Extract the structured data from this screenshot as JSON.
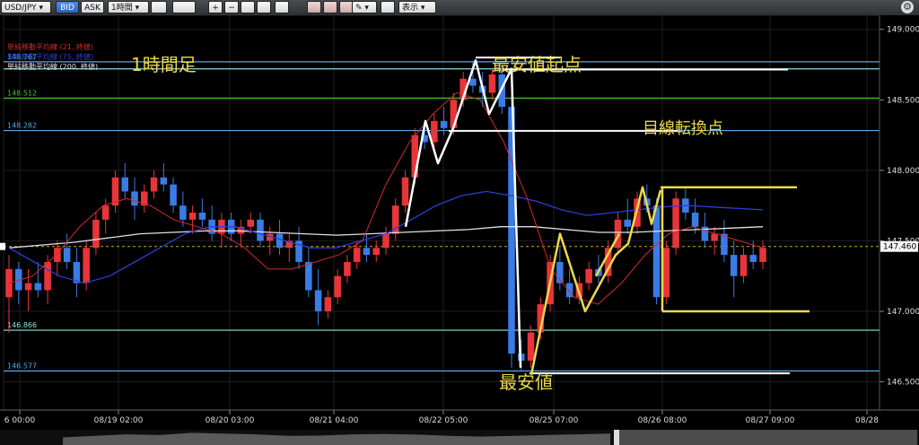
{
  "toolbar": {
    "symbol": "USD/JPY",
    "bid": "BID",
    "ask": "ASK",
    "timeframe": "1時間",
    "display": "表示"
  },
  "indicator_legend": [
    {
      "label": "単純移動平均線 (21, 終値)",
      "color": "#d42a2a"
    },
    {
      "label": "単純移動平均線 (75, 終値)",
      "color": "#2a3ed4"
    },
    {
      "label": "単純移動平均線 (200, 終値)",
      "color": "#e0e0e0"
    }
  ],
  "annotations": {
    "timeframe_title": "1時間足",
    "lowest_start": "最安値起点",
    "reversal_point": "目線転換点",
    "lowest": "最安値"
  },
  "colors": {
    "up": "#e8353a",
    "down": "#3a7be6",
    "sma21": "#d42a2a",
    "sma75": "#2a3ed4",
    "sma200": "#e0e0e0",
    "annotation": "#ecd94a"
  },
  "chart_data": {
    "type": "candlestick",
    "ylim": [
      146.3,
      149.1
    ],
    "y_ticks": [
      146.5,
      147.0,
      147.5,
      148.0,
      148.5,
      149.0
    ],
    "y_tick_labels": [
      "146.500",
      "147.000",
      "147.500",
      "148.000",
      "148.500",
      "149.000"
    ],
    "x_tick_labels": [
      "6 00:00",
      "08/19 02:00",
      "08/20 03:00",
      "08/21 04:00",
      "08/22 05:00",
      "08/25 07:00",
      "08/26 08:00",
      "08/27 09:00",
      "08/28"
    ],
    "current_price": {
      "value": 147.46,
      "label": "147.460"
    },
    "horizontal_levels": [
      {
        "value": 148.77,
        "label": "148.767",
        "color": "#5aa8e6"
      },
      {
        "value": 148.72,
        "label": "",
        "color": "#8fd6e8"
      },
      {
        "value": 148.512,
        "label": "148.512",
        "color": "#4cbb3a"
      },
      {
        "value": 148.282,
        "label": "148.282",
        "color": "#5aa8e6"
      },
      {
        "value": 146.866,
        "label": "146.866",
        "color": "#8fe6d6"
      },
      {
        "value": 146.577,
        "label": "146.577",
        "color": "#5aa8e6"
      }
    ],
    "candles": [
      {
        "o": 147.1,
        "h": 147.4,
        "l": 146.85,
        "c": 147.3
      },
      {
        "o": 147.3,
        "h": 147.35,
        "l": 147.05,
        "c": 147.15
      },
      {
        "o": 147.15,
        "h": 147.3,
        "l": 147.0,
        "c": 147.2
      },
      {
        "o": 147.2,
        "h": 147.35,
        "l": 147.1,
        "c": 147.15
      },
      {
        "o": 147.15,
        "h": 147.4,
        "l": 147.05,
        "c": 147.35
      },
      {
        "o": 147.35,
        "h": 147.5,
        "l": 147.25,
        "c": 147.45
      },
      {
        "o": 147.45,
        "h": 147.55,
        "l": 147.3,
        "c": 147.35
      },
      {
        "o": 147.35,
        "h": 147.45,
        "l": 147.1,
        "c": 147.2
      },
      {
        "o": 147.2,
        "h": 147.5,
        "l": 147.15,
        "c": 147.45
      },
      {
        "o": 147.45,
        "h": 147.7,
        "l": 147.4,
        "c": 147.65
      },
      {
        "o": 147.65,
        "h": 147.8,
        "l": 147.55,
        "c": 147.75
      },
      {
        "o": 147.75,
        "h": 148.0,
        "l": 147.7,
        "c": 147.95
      },
      {
        "o": 147.95,
        "h": 148.05,
        "l": 147.8,
        "c": 147.85
      },
      {
        "o": 147.85,
        "h": 147.95,
        "l": 147.65,
        "c": 147.75
      },
      {
        "o": 147.75,
        "h": 147.9,
        "l": 147.7,
        "c": 147.85
      },
      {
        "o": 147.85,
        "h": 148.0,
        "l": 147.8,
        "c": 147.95
      },
      {
        "o": 147.95,
        "h": 148.05,
        "l": 147.85,
        "c": 147.9
      },
      {
        "o": 147.9,
        "h": 147.95,
        "l": 147.7,
        "c": 147.75
      },
      {
        "o": 147.75,
        "h": 147.85,
        "l": 147.6,
        "c": 147.65
      },
      {
        "o": 147.65,
        "h": 147.75,
        "l": 147.55,
        "c": 147.7
      },
      {
        "o": 147.7,
        "h": 147.8,
        "l": 147.6,
        "c": 147.65
      },
      {
        "o": 147.65,
        "h": 147.75,
        "l": 147.5,
        "c": 147.55
      },
      {
        "o": 147.55,
        "h": 147.7,
        "l": 147.45,
        "c": 147.65
      },
      {
        "o": 147.65,
        "h": 147.7,
        "l": 147.5,
        "c": 147.55
      },
      {
        "o": 147.55,
        "h": 147.65,
        "l": 147.45,
        "c": 147.6
      },
      {
        "o": 147.6,
        "h": 147.7,
        "l": 147.55,
        "c": 147.65
      },
      {
        "o": 147.65,
        "h": 147.7,
        "l": 147.45,
        "c": 147.5
      },
      {
        "o": 147.5,
        "h": 147.6,
        "l": 147.4,
        "c": 147.55
      },
      {
        "o": 147.55,
        "h": 147.65,
        "l": 147.4,
        "c": 147.45
      },
      {
        "o": 147.45,
        "h": 147.55,
        "l": 147.35,
        "c": 147.5
      },
      {
        "o": 147.5,
        "h": 147.6,
        "l": 147.3,
        "c": 147.35
      },
      {
        "o": 147.35,
        "h": 147.45,
        "l": 147.1,
        "c": 147.15
      },
      {
        "o": 147.15,
        "h": 147.3,
        "l": 146.9,
        "c": 147.0
      },
      {
        "o": 147.0,
        "h": 147.15,
        "l": 146.95,
        "c": 147.1
      },
      {
        "o": 147.1,
        "h": 147.3,
        "l": 147.05,
        "c": 147.25
      },
      {
        "o": 147.25,
        "h": 147.4,
        "l": 147.2,
        "c": 147.35
      },
      {
        "o": 147.35,
        "h": 147.5,
        "l": 147.3,
        "c": 147.45
      },
      {
        "o": 147.45,
        "h": 147.55,
        "l": 147.35,
        "c": 147.4
      },
      {
        "o": 147.4,
        "h": 147.5,
        "l": 147.35,
        "c": 147.45
      },
      {
        "o": 147.45,
        "h": 147.6,
        "l": 147.4,
        "c": 147.55
      },
      {
        "o": 147.55,
        "h": 147.8,
        "l": 147.5,
        "c": 147.75
      },
      {
        "o": 147.75,
        "h": 148.0,
        "l": 147.7,
        "c": 147.95
      },
      {
        "o": 147.95,
        "h": 148.3,
        "l": 147.9,
        "c": 148.25
      },
      {
        "o": 148.25,
        "h": 148.35,
        "l": 148.15,
        "c": 148.2
      },
      {
        "o": 148.2,
        "h": 148.4,
        "l": 148.15,
        "c": 148.35
      },
      {
        "o": 148.35,
        "h": 148.45,
        "l": 148.25,
        "c": 148.3
      },
      {
        "o": 148.3,
        "h": 148.55,
        "l": 148.25,
        "c": 148.5
      },
      {
        "o": 148.5,
        "h": 148.7,
        "l": 148.45,
        "c": 148.65
      },
      {
        "o": 148.65,
        "h": 148.78,
        "l": 148.55,
        "c": 148.6
      },
      {
        "o": 148.6,
        "h": 148.7,
        "l": 148.45,
        "c": 148.55
      },
      {
        "o": 148.55,
        "h": 148.72,
        "l": 148.5,
        "c": 148.68
      },
      {
        "o": 148.68,
        "h": 148.74,
        "l": 148.4,
        "c": 148.45
      },
      {
        "o": 148.45,
        "h": 148.55,
        "l": 146.6,
        "c": 146.7
      },
      {
        "o": 146.7,
        "h": 146.8,
        "l": 146.58,
        "c": 146.65
      },
      {
        "o": 146.65,
        "h": 146.9,
        "l": 146.6,
        "c": 146.85
      },
      {
        "o": 146.85,
        "h": 147.1,
        "l": 146.8,
        "c": 147.05
      },
      {
        "o": 147.05,
        "h": 147.4,
        "l": 147.0,
        "c": 147.35
      },
      {
        "o": 147.35,
        "h": 147.45,
        "l": 147.15,
        "c": 147.2
      },
      {
        "o": 147.2,
        "h": 147.3,
        "l": 147.05,
        "c": 147.1
      },
      {
        "o": 147.1,
        "h": 147.25,
        "l": 147.05,
        "c": 147.2
      },
      {
        "o": 147.2,
        "h": 147.35,
        "l": 147.15,
        "c": 147.3
      },
      {
        "o": 147.3,
        "h": 147.4,
        "l": 147.2,
        "c": 147.25
      },
      {
        "o": 147.25,
        "h": 147.5,
        "l": 147.2,
        "c": 147.45
      },
      {
        "o": 147.45,
        "h": 147.7,
        "l": 147.4,
        "c": 147.65
      },
      {
        "o": 147.65,
        "h": 147.8,
        "l": 147.55,
        "c": 147.6
      },
      {
        "o": 147.6,
        "h": 147.85,
        "l": 147.55,
        "c": 147.8
      },
      {
        "o": 147.8,
        "h": 147.9,
        "l": 147.7,
        "c": 147.75
      },
      {
        "o": 147.75,
        "h": 147.8,
        "l": 147.05,
        "c": 147.1
      },
      {
        "o": 147.1,
        "h": 147.5,
        "l": 147.05,
        "c": 147.45
      },
      {
        "o": 147.45,
        "h": 147.85,
        "l": 147.4,
        "c": 147.8
      },
      {
        "o": 147.8,
        "h": 147.88,
        "l": 147.65,
        "c": 147.7
      },
      {
        "o": 147.7,
        "h": 147.8,
        "l": 147.55,
        "c": 147.6
      },
      {
        "o": 147.6,
        "h": 147.7,
        "l": 147.45,
        "c": 147.5
      },
      {
        "o": 147.5,
        "h": 147.6,
        "l": 147.4,
        "c": 147.55
      },
      {
        "o": 147.55,
        "h": 147.65,
        "l": 147.35,
        "c": 147.4
      },
      {
        "o": 147.4,
        "h": 147.5,
        "l": 147.1,
        "c": 147.25
      },
      {
        "o": 147.25,
        "h": 147.45,
        "l": 147.2,
        "c": 147.4
      },
      {
        "o": 147.4,
        "h": 147.5,
        "l": 147.3,
        "c": 147.35
      },
      {
        "o": 147.35,
        "h": 147.5,
        "l": 147.3,
        "c": 147.45
      }
    ],
    "sma21": [
      147.2,
      147.25,
      147.4,
      147.6,
      147.75,
      147.8,
      147.75,
      147.65,
      147.6,
      147.55,
      147.45,
      147.3,
      147.3,
      147.35,
      147.4,
      147.5,
      147.9,
      148.2,
      148.4,
      148.55,
      148.5,
      148.2,
      147.8,
      147.3,
      147.1,
      147.05,
      147.2,
      147.4,
      147.55,
      147.6,
      147.55,
      147.5,
      147.45
    ],
    "sma75": [
      147.45,
      147.35,
      147.25,
      147.2,
      147.25,
      147.35,
      147.45,
      147.55,
      147.6,
      147.6,
      147.55,
      147.5,
      147.45,
      147.45,
      147.5,
      147.55,
      147.65,
      147.75,
      147.82,
      147.85,
      147.82,
      147.78,
      147.72,
      147.68,
      147.7,
      147.72,
      147.74,
      147.75,
      147.74,
      147.73,
      147.72
    ],
    "sma200": [
      147.45,
      147.47,
      147.49,
      147.52,
      147.55,
      147.56,
      147.57,
      147.57,
      147.56,
      147.55,
      147.54,
      147.55,
      147.56,
      147.57,
      147.58,
      147.6,
      147.6,
      147.58,
      147.56,
      147.56,
      147.57,
      147.58,
      147.59,
      147.6
    ]
  }
}
